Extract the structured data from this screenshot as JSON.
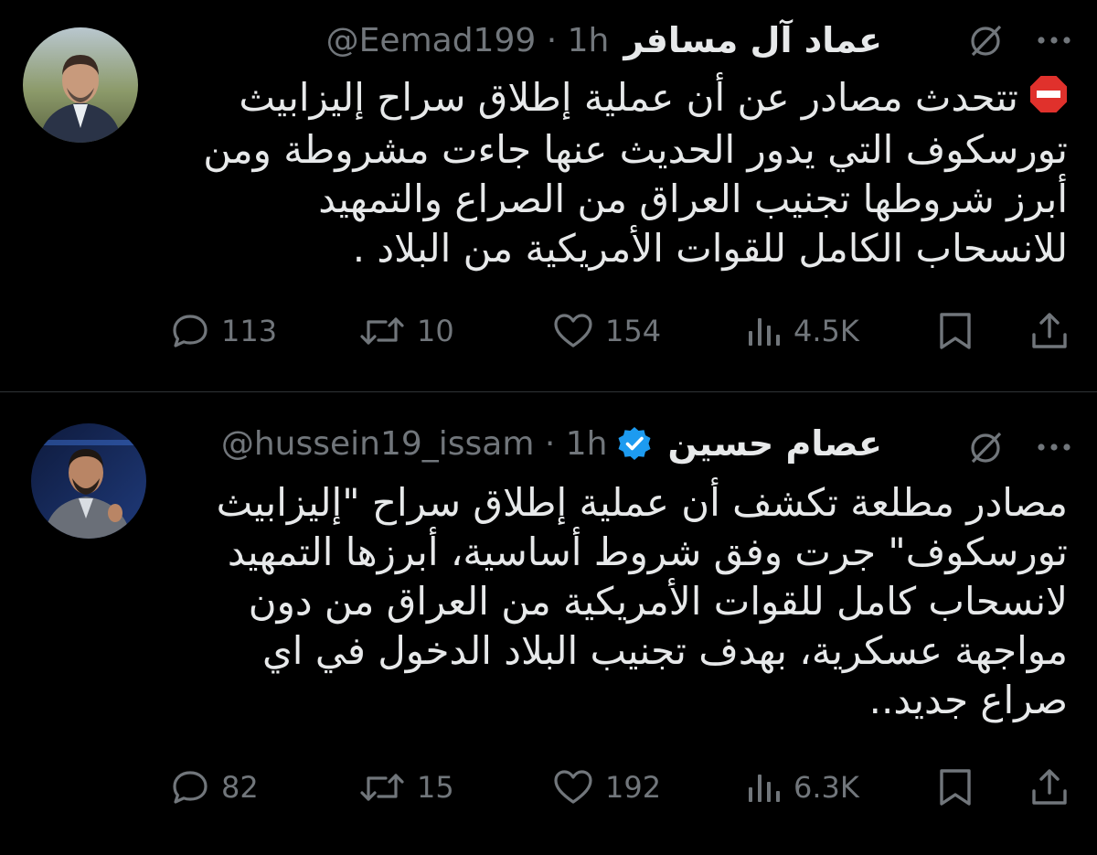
{
  "tweets": [
    {
      "display_name": "عماد آل مسافر",
      "handle": "@Eemad199",
      "time": "1h",
      "verified": false,
      "emoji": "stop-sign",
      "text": "تتحدث مصادر عن أن عملية إطلاق سراح إليزابيث تورسكوف التي يدور الحديث عنها جاءت مشروطة ومن أبرز شروطها تجنيب العراق من الصراع والتمهيد للانسحاب الكامل للقوات الأمريكية من البلاد .",
      "replies": "113",
      "retweets": "10",
      "likes": "154",
      "views": "4.5K"
    },
    {
      "display_name": "عصام حسين",
      "handle": "@hussein19_issam",
      "time": "1h",
      "verified": true,
      "text": "مصادر مطلعة تكشف أن عملية إطلاق سراح \"إليزابيث تورسكوف\" جرت وفق شروط أساسية، أبرزها التمهيد لانسحاب كامل للقوات الأمريكية من العراق من دون مواجهة عسكرية، بهدف تجنيب البلاد الدخول في اي صراع جديد..",
      "replies": "82",
      "retweets": "15",
      "likes": "192",
      "views": "6.3K"
    }
  ],
  "icons": {
    "reply": "speech-bubble-icon",
    "retweet": "retweet-arrows-icon",
    "like": "heart-icon",
    "views": "bar-chart-icon",
    "bookmark": "bookmark-icon",
    "share": "share-arrow-icon",
    "grok": "slashed-circle-icon",
    "more": "three-dots-icon",
    "verified": "blue-check-badge-icon"
  },
  "colors": {
    "background": "#000000",
    "text": "#e7e9ea",
    "muted": "#71767b",
    "verified": "#1d9bf0",
    "stop": "#e0312c"
  }
}
